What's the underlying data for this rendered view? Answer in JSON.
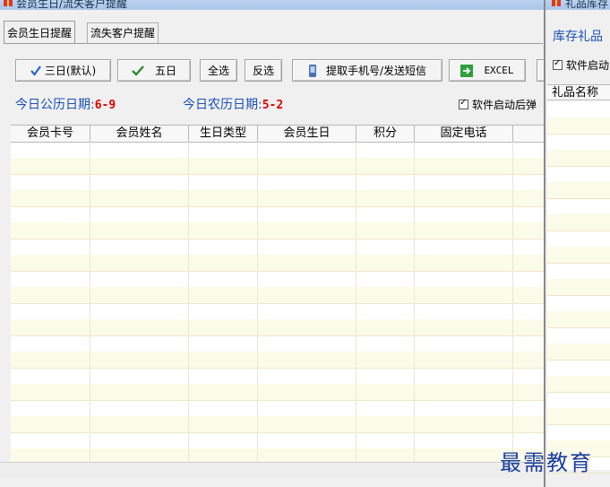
{
  "left_window": {
    "title": "会员生日/流失客户提醒",
    "tabs": [
      {
        "label": "会员生日提醒",
        "active": true
      },
      {
        "label": "流失客户提醒",
        "active": false
      }
    ],
    "buttons": {
      "three_days": "三日(默认)",
      "five_days": "五日",
      "select_all": "全选",
      "invert": "反选",
      "send_sms": "提取手机号/发送短信",
      "excel": "EXCEL"
    },
    "today_solar_label": "今日公历日期:",
    "today_solar_value": "6-9",
    "today_lunar_label": "今日农历日期:",
    "today_lunar_value": "5-2",
    "startup_checkbox": {
      "label": "软件启动后弹",
      "checked": true
    },
    "table": {
      "columns": [
        "会员卡号",
        "会员姓名",
        "生日类型",
        "会员生日",
        "积分",
        "固定电话"
      ],
      "rows": []
    }
  },
  "right_window": {
    "title": "礼品库存",
    "heading": "库存礼品",
    "startup_checkbox": {
      "label": "软件启动",
      "checked": true
    },
    "table": {
      "columns": [
        "礼品名称"
      ],
      "rows": []
    }
  },
  "watermark": "最需教育",
  "colors": {
    "accent_blue": "#1a4fb5",
    "date_red": "#e00000",
    "row_alt": "#fbfbe9",
    "title_bar": "#b7cfee"
  }
}
